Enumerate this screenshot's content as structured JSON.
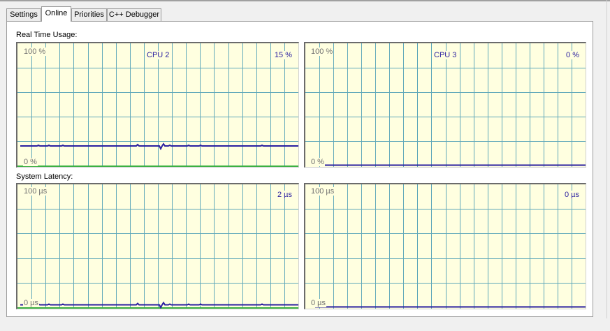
{
  "tabs": [
    "Settings",
    "Online",
    "Priorities",
    "C++ Debugger"
  ],
  "active_tab": "Online",
  "sections": {
    "real_time_usage": "Real Time Usage:",
    "system_latency": "System Latency:"
  },
  "cpu_graphs": [
    {
      "name": "CPU 2",
      "value": "15 %",
      "top": "100 %",
      "bottom": "0 %",
      "level": 0.16
    },
    {
      "name": "CPU 3",
      "value": "0 %",
      "top": "100 %",
      "bottom": "0 %",
      "level": 0.0
    }
  ],
  "latency_graphs": [
    {
      "value": "2 µs",
      "top": "100 µs",
      "bottom": "0 µs",
      "level": 0.02
    },
    {
      "value": "0 µs",
      "top": "100 µs",
      "bottom": "0 µs",
      "level": 0.0
    }
  ],
  "colors": {
    "graph_background": "#ffffe0",
    "grid": "#5fa8ba",
    "trace": "#2a1fa0",
    "baseline": "#3cb043",
    "frame": "#6b6b6b"
  }
}
